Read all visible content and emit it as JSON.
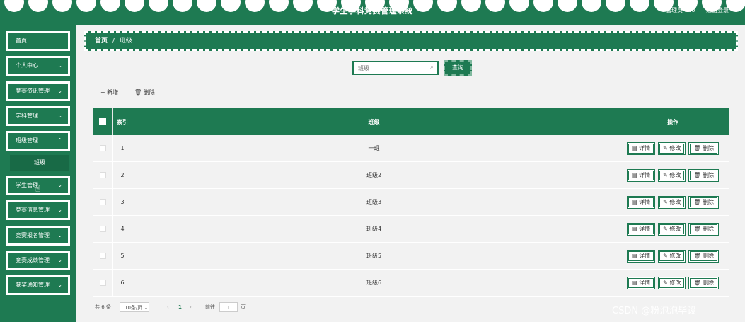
{
  "header": {
    "title": "学生学科竞赛管理系统",
    "user": "管理员 abo",
    "logout": "退出登录"
  },
  "sidebar": {
    "items": [
      {
        "label": "首页",
        "chevron": false
      },
      {
        "label": "个人中心",
        "chevron": true
      },
      {
        "label": "竞赛资讯管理",
        "chevron": true
      },
      {
        "label": "学科管理",
        "chevron": true
      },
      {
        "label": "班级管理",
        "chevron": true
      },
      {
        "label": "学生管理",
        "chevron": true
      },
      {
        "label": "竞赛信息管理",
        "chevron": true
      },
      {
        "label": "竞赛报名管理",
        "chevron": true
      },
      {
        "label": "竞赛成绩管理",
        "chevron": true
      },
      {
        "label": "获奖通知管理",
        "chevron": true
      }
    ],
    "active_sub": "班级"
  },
  "breadcrumb": {
    "home": "首页",
    "sep": "/",
    "current": "班级"
  },
  "search": {
    "placeholder": "班级",
    "button": "查询"
  },
  "toolbar": {
    "add": "+ 新增",
    "delete": "🗑 删除"
  },
  "table": {
    "headers": {
      "index": "索引",
      "class": "班级",
      "actions": "操作"
    },
    "rows": [
      {
        "index": "1",
        "class": "一班"
      },
      {
        "index": "2",
        "class": "班级2"
      },
      {
        "index": "3",
        "class": "班级3"
      },
      {
        "index": "4",
        "class": "班级4"
      },
      {
        "index": "5",
        "class": "班级5"
      },
      {
        "index": "6",
        "class": "班级6"
      }
    ],
    "actions": {
      "detail": "详情",
      "edit": "修改",
      "delete": "删除"
    }
  },
  "pagination": {
    "total": "共 6 条",
    "page_size": "10条/页",
    "prev": "‹",
    "current": "1",
    "next": "›",
    "goto_label": "前往",
    "goto_value": "1",
    "page_unit": "页"
  },
  "watermark": "CSDN @粉泡泡毕设",
  "colors": {
    "primary": "#1e7a52",
    "background": "#f2f2f2"
  }
}
